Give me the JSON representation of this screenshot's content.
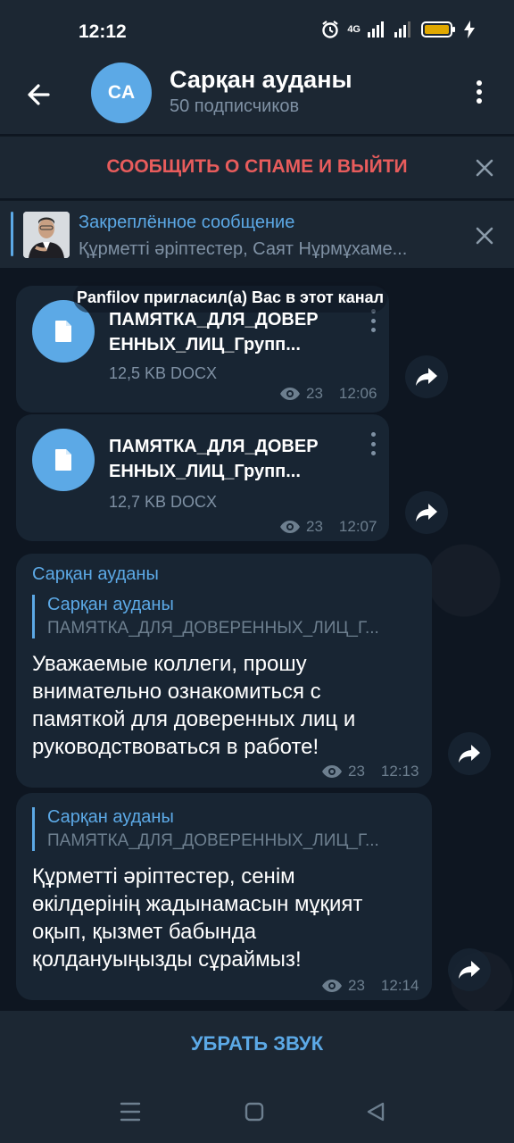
{
  "status_bar": {
    "time": "12:12",
    "network": "4G"
  },
  "header": {
    "avatar_initials": "CA",
    "title": "Сарқан ауданы",
    "subtitle": "50 подписчиков"
  },
  "spam_bar": {
    "label": "СООБЩИТЬ О СПАМЕ И ВЫЙТИ"
  },
  "pinned": {
    "title": "Закреплённое сообщение",
    "text": "Құрметті әріптестер, Саят Нұрмұхаме..."
  },
  "service_message": "Panfilov пригласил(а) Вас в этот канал",
  "messages": [
    {
      "file_name_line1": "ПАМЯТКА_ДЛЯ_ДОВЕР",
      "file_name_line2": "ЕННЫХ_ЛИЦ_Групп...",
      "file_size": "12,5 KB DOCX",
      "views": "23",
      "time": "12:06"
    },
    {
      "file_name_line1": "ПАМЯТКА_ДЛЯ_ДОВЕР",
      "file_name_line2": "ЕННЫХ_ЛИЦ_Групп...",
      "file_size": "12,7 KB DOCX",
      "views": "23",
      "time": "12:07"
    },
    {
      "sender": "Сарқан ауданы",
      "quote_title": "Сарқан ауданы",
      "quote_text": "ПАМЯТКА_ДЛЯ_ДОВЕРЕННЫХ_ЛИЦ_Г...",
      "text": "Уважаемые коллеги, прошу внимательно ознакомиться с памяткой для доверенных лиц и руководствоваться в работе!",
      "views": "23",
      "time": "12:13"
    },
    {
      "quote_title": "Сарқан ауданы",
      "quote_text": "ПАМЯТКА_ДЛЯ_ДОВЕРЕННЫХ_ЛИЦ_Г...",
      "text": "Құрметті әріптестер, сенім өкілдерінің жадынамасын мұқият оқып, қызмет бабында қолдануыңызды сұраймыз!",
      "views": "23",
      "time": "12:14"
    }
  ],
  "mute_bar": {
    "label": "УБРАТЬ ЗВУК"
  },
  "colors": {
    "accent": "#5ca9e6",
    "spam_red": "#e85c5c",
    "bubble": "#182533",
    "bar": "#1c2733",
    "background": "#0e1621"
  }
}
